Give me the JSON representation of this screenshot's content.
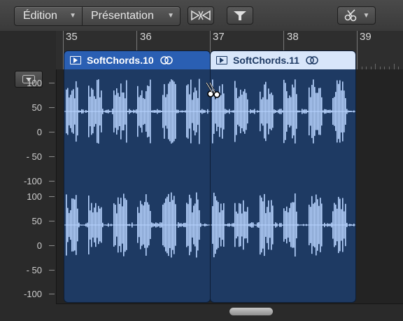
{
  "toolbar": {
    "edit_menu": "Édition",
    "view_menu": "Présentation",
    "buttons": [
      "snap-icon",
      "flex-icon",
      "scissors-tool-icon"
    ]
  },
  "ruler": {
    "bars": [
      "35",
      "36",
      "37",
      "38",
      "39"
    ]
  },
  "amplitude_scale": {
    "upper": [
      "100",
      "50",
      "0",
      "- 50",
      "-100"
    ],
    "lower": [
      "100",
      "50",
      "0",
      "- 50",
      "-100"
    ]
  },
  "regions": [
    {
      "name": "SoftChords.10",
      "selected": true
    },
    {
      "name": "SoftChords.11",
      "selected": false
    }
  ],
  "colors": {
    "region_selected_header": "#2a5fb3",
    "region_unselected_header": "#d8e6fa",
    "region_body": "#1e3a63",
    "waveform": "#b8d4ff"
  }
}
